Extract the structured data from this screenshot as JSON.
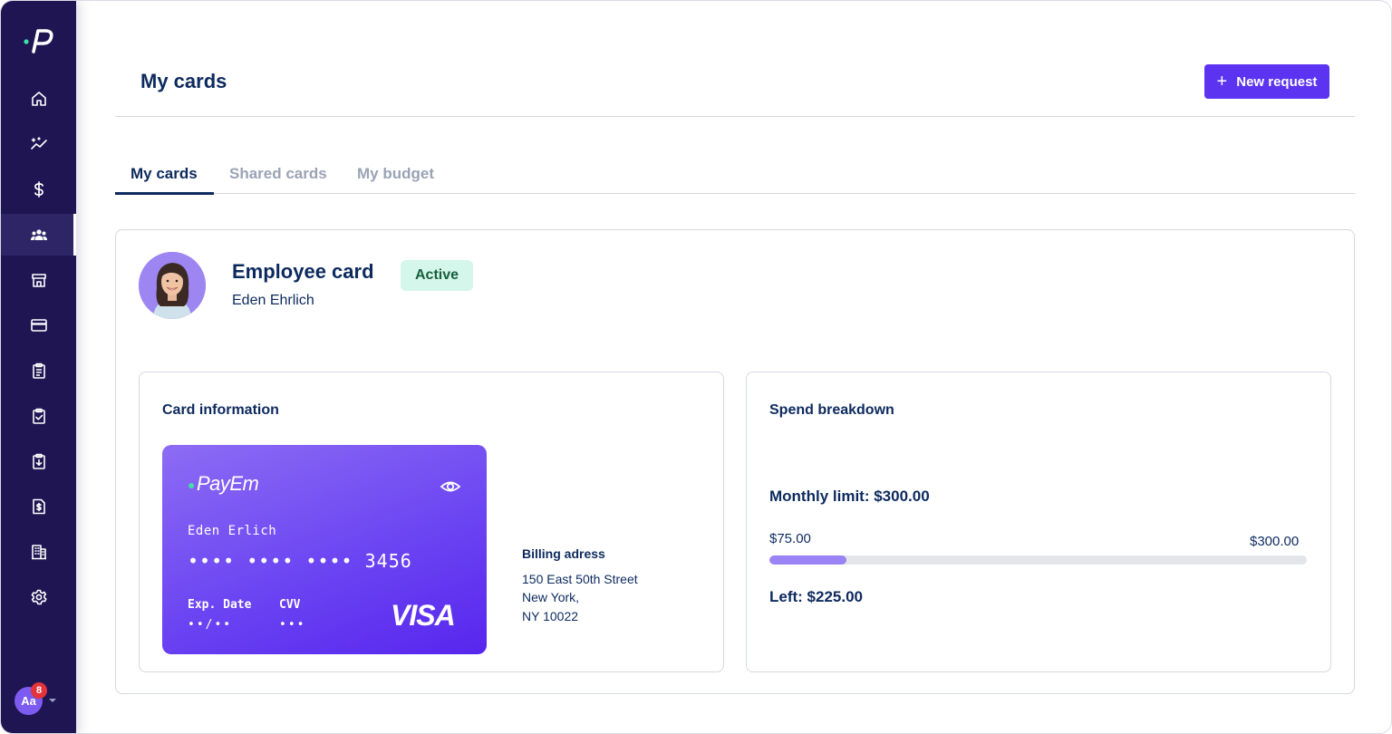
{
  "header": {
    "title": "My cards",
    "new_request_label": "New request"
  },
  "tabs": [
    {
      "label": "My cards",
      "active": true
    },
    {
      "label": "Shared cards",
      "active": false
    },
    {
      "label": "My budget",
      "active": false
    }
  ],
  "sidebar": {
    "items": [
      {
        "icon": "home-icon"
      },
      {
        "icon": "insights-icon"
      },
      {
        "icon": "dollar-icon"
      },
      {
        "icon": "team-icon",
        "active": true
      },
      {
        "icon": "store-icon"
      },
      {
        "icon": "credit-card-icon"
      },
      {
        "icon": "clipboard-list-icon"
      },
      {
        "icon": "clipboard-check-icon"
      },
      {
        "icon": "clipboard-download-icon"
      },
      {
        "icon": "invoice-icon"
      },
      {
        "icon": "building-icon"
      },
      {
        "icon": "settings-icon"
      }
    ],
    "user": {
      "initials": "Aa",
      "notifications": "8"
    }
  },
  "employee_card": {
    "title": "Employee card",
    "owner": "Eden Ehrlich",
    "status": "Active"
  },
  "card_info": {
    "section_title": "Card information",
    "brand": "PayEm",
    "cardholder": "Eden Erlich",
    "number_masked": "•••• •••• •••• 3456",
    "exp_label": "Exp. Date",
    "exp_value": "••/••",
    "cvv_label": "CVV",
    "cvv_value": "•••",
    "network": "VISA",
    "billing": {
      "title": "Billing adress",
      "line1": "150 East 50th Street",
      "line2": "New York,",
      "line3": "NY 10022"
    }
  },
  "spend": {
    "section_title": "Spend breakdown",
    "monthly_limit_text": "Monthly limit: $300.00",
    "spent_label": "$75.00",
    "limit_label": "$300.00",
    "progress_fraction": 0.143,
    "left_text": "Left: $225.00"
  },
  "colors": {
    "sidebar_bg": "#1f1552",
    "accent": "#5b33f0",
    "text_primary": "#0d2a5e",
    "status_active_bg": "#d5f6ea",
    "progress_fill": "#9a84f5"
  }
}
